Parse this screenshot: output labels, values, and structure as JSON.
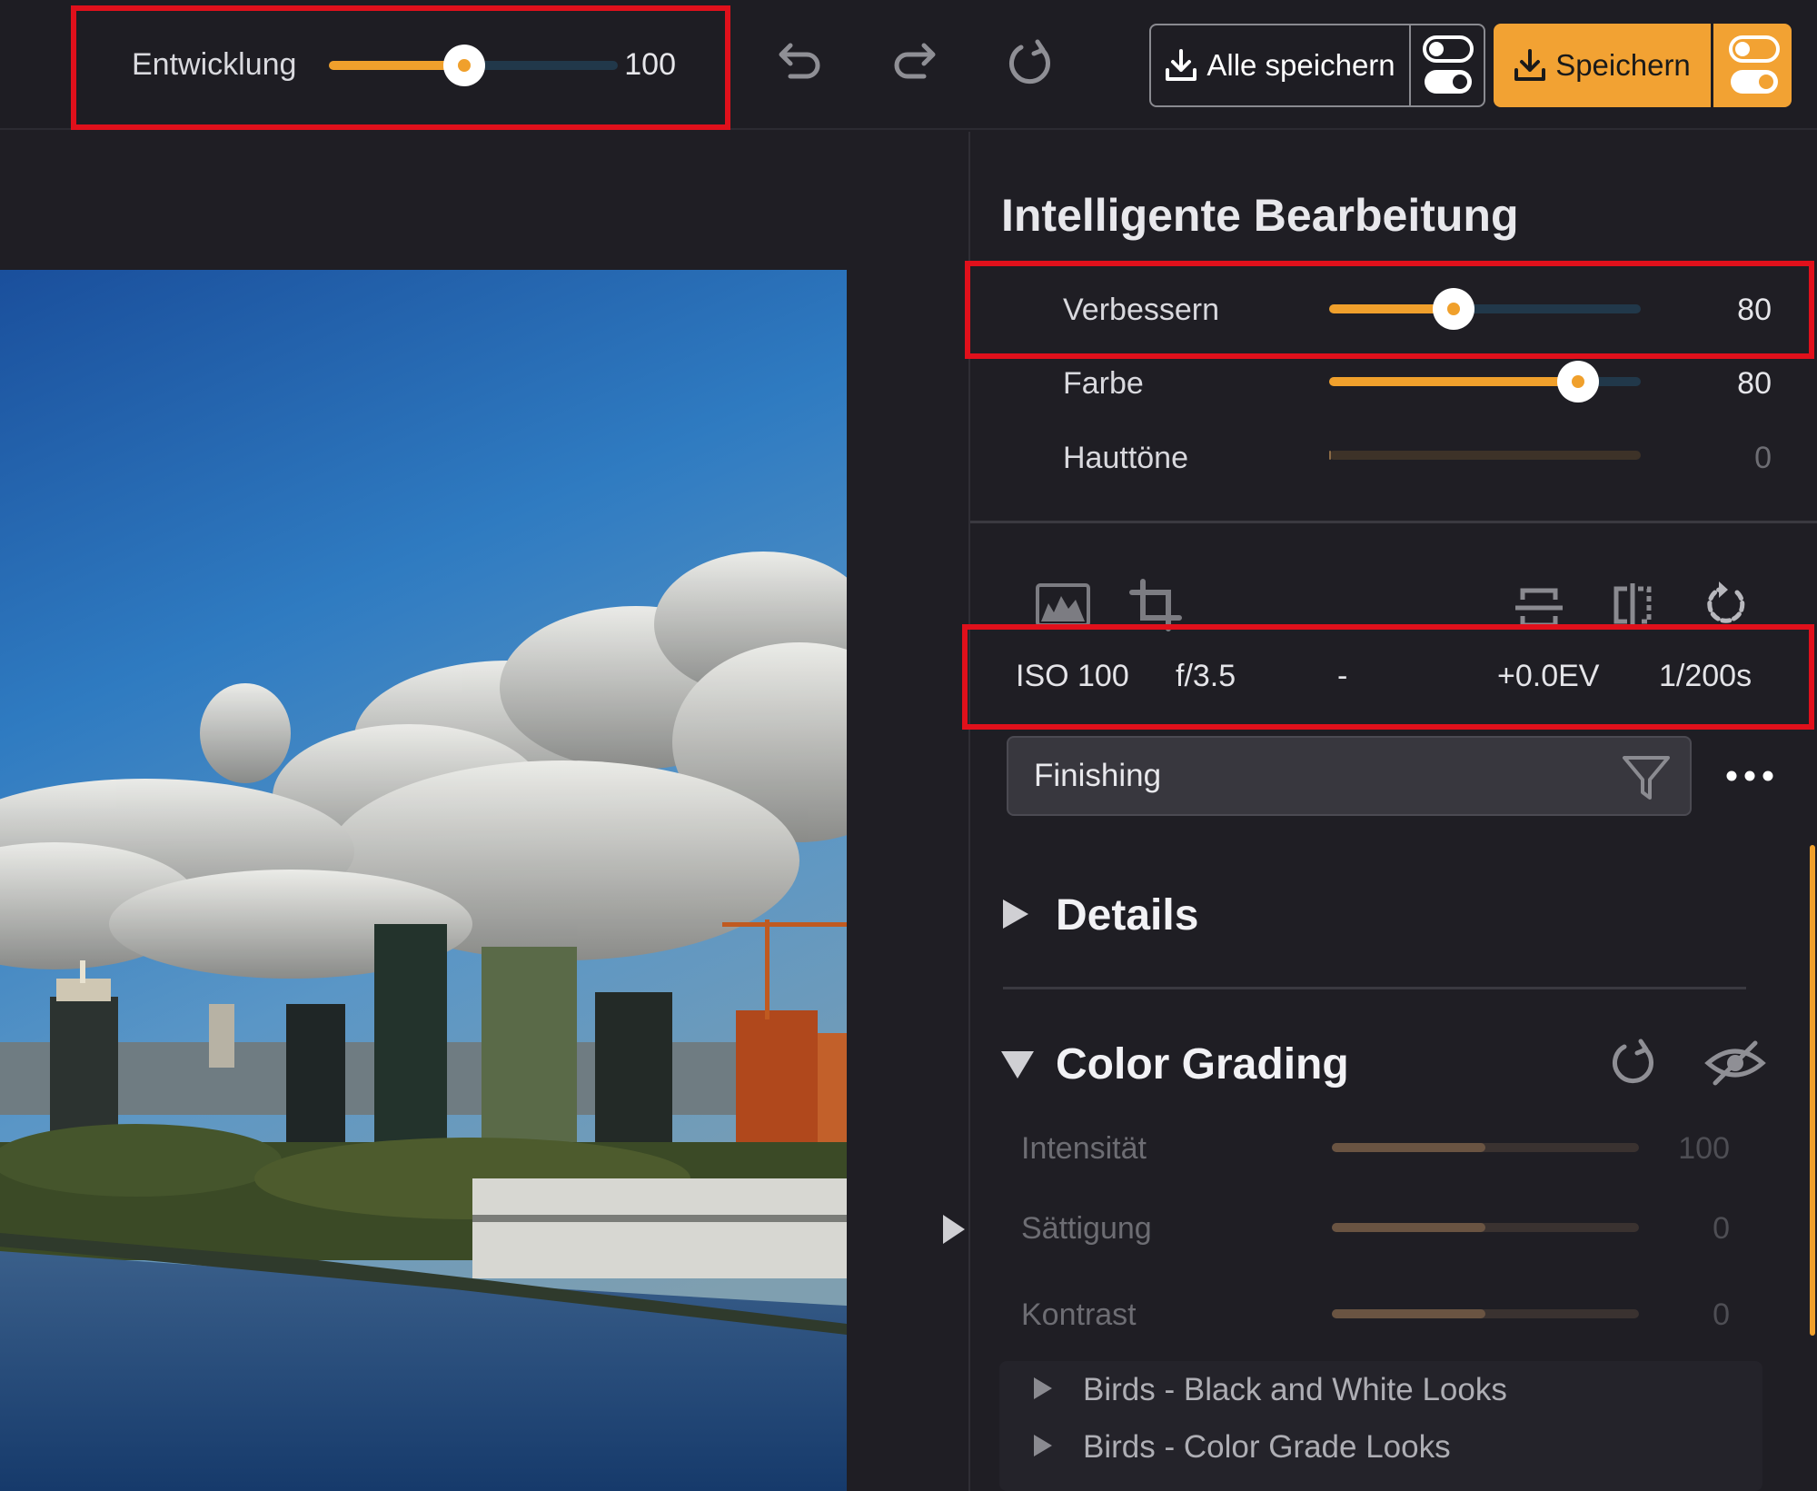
{
  "toolbar": {
    "development": {
      "label": "Entwicklung",
      "value": "100",
      "fraction": 0.47
    },
    "save_all_label": "Alle speichern",
    "save_label": "Speichern",
    "accent_color": "#f2a233",
    "icons": [
      "undo-icon",
      "redo-icon",
      "reset-icon",
      "download-icon",
      "toggle-icon"
    ]
  },
  "panel": {
    "title": "Intelligente Bearbeitung",
    "sliders": [
      {
        "label": "Verbessern",
        "value": "80",
        "fraction": 0.4
      },
      {
        "label": "Farbe",
        "value": "80",
        "fraction": 0.8
      },
      {
        "label": "Hauttöne",
        "value": "0",
        "fraction": 0.0
      }
    ],
    "tool_icons": [
      "histogram-icon",
      "crop-icon",
      "straighten-icon",
      "flip-icon",
      "rotate-icon"
    ],
    "exif": {
      "iso": "ISO 100",
      "aperture": "f/3.5",
      "focal": "-",
      "ev": "+0.0EV",
      "shutter": "1/200s"
    },
    "filter": {
      "text": "Finishing",
      "icon": "filter-icon",
      "more_icon": "more-icon"
    },
    "details": {
      "title": "Details",
      "expanded": false
    },
    "color_grading": {
      "title": "Color Grading",
      "expanded": true,
      "icons": [
        "reset-icon",
        "eye-hidden-icon"
      ],
      "sliders": [
        {
          "label": "Intensität",
          "value": "100",
          "fraction": 0.5
        },
        {
          "label": "Sättigung",
          "value": "0",
          "fraction": 0.5
        },
        {
          "label": "Kontrast",
          "value": "0",
          "fraction": 0.5
        }
      ],
      "presets": [
        "Birds - Black and White Looks",
        "Birds - Color Grade Looks"
      ]
    }
  }
}
